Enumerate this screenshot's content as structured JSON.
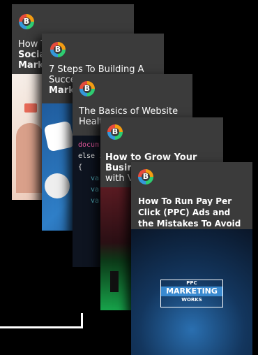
{
  "cards": [
    {
      "line1": "How T",
      "line2": "Socia",
      "line3": "Mark"
    },
    {
      "line1": "7 Steps To Building A",
      "line2": "Succe",
      "line3": "Mark"
    },
    {
      "line1": "The Basics of Website",
      "line2": "Healt",
      "code": [
        "docum",
        "else i",
        "{",
        "va",
        "va",
        "va"
      ]
    },
    {
      "line1": "How to Grow Your",
      "line2": "Busin",
      "line3": "with V"
    },
    {
      "line1": "How To Run Pay Per",
      "line2": "Click (PPC) Ads and",
      "line3": "the Mistakes To Avoid",
      "badge_top": "PPC",
      "badge_mid": "MARKETING",
      "badge_bot": "WORKS"
    }
  ],
  "logo_glyph": "B",
  "colors": {
    "background": "#000000",
    "card": "#3b3b3b",
    "text": "#ffffff"
  }
}
